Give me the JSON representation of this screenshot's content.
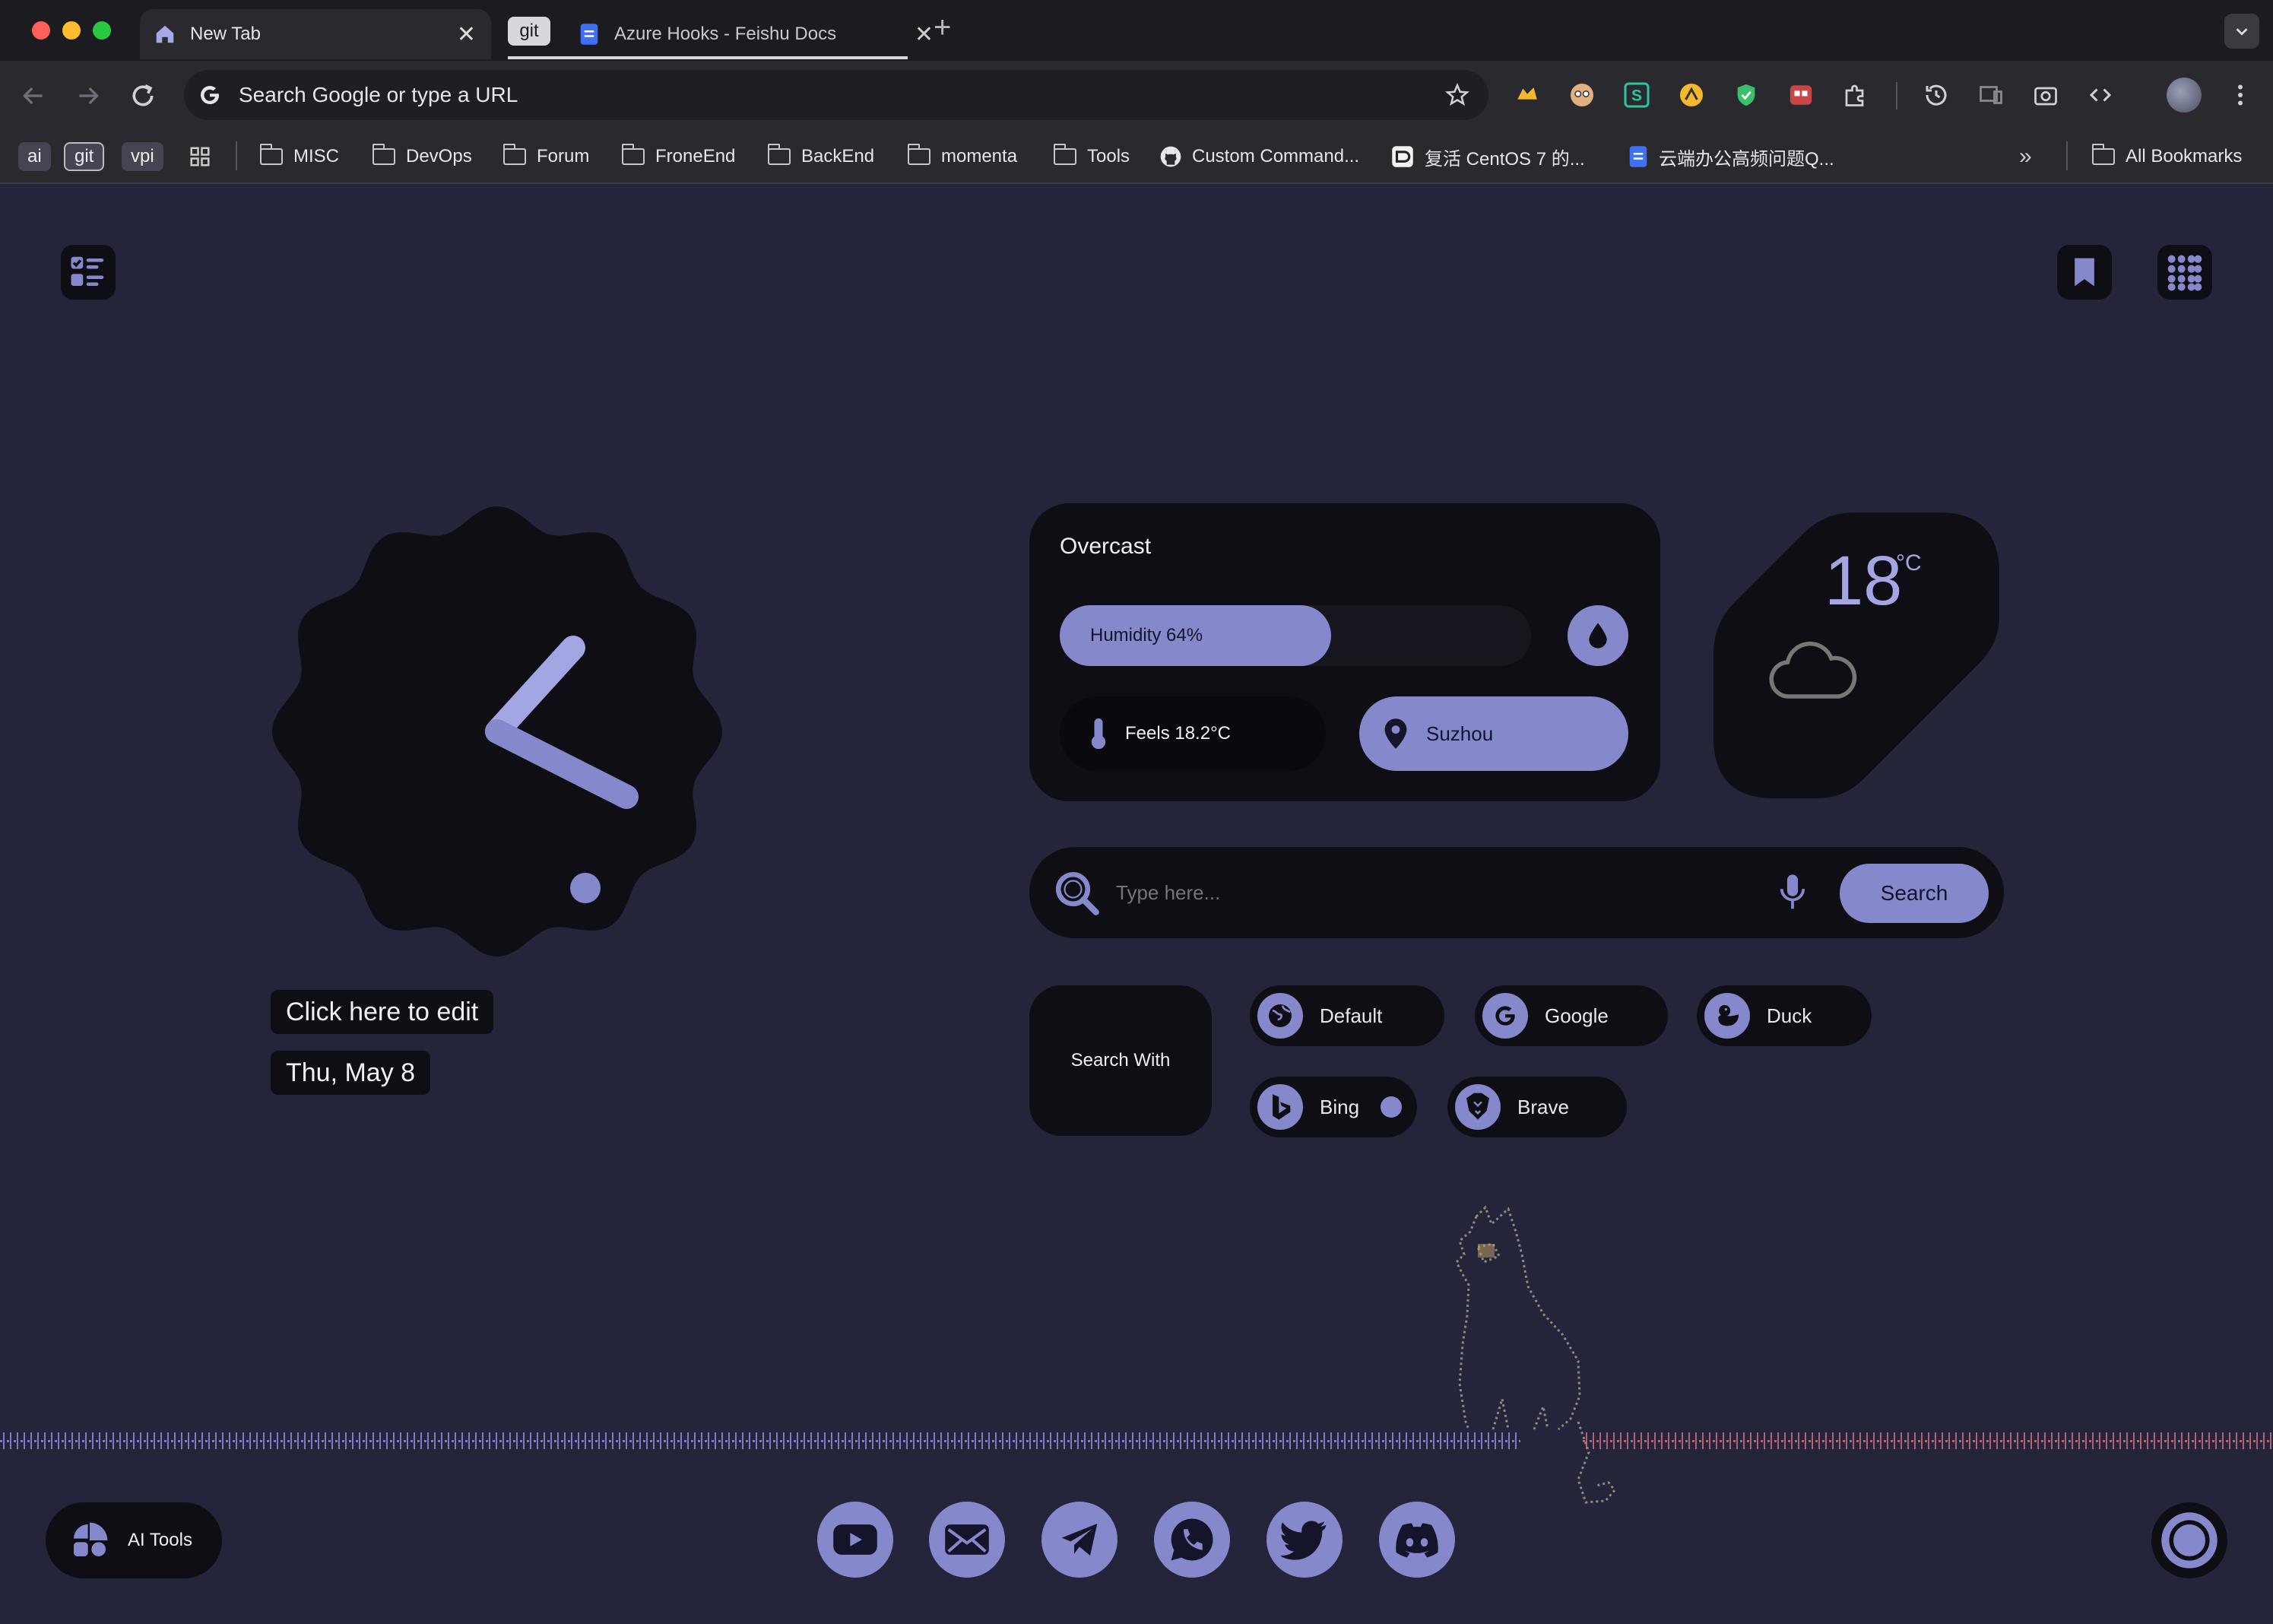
{
  "browser": {
    "tabs": [
      {
        "label": "New Tab",
        "active": true
      },
      {
        "label": "Azure Hooks - Feishu Docs",
        "group": "git",
        "active": false
      }
    ],
    "omnibox_placeholder": "Search Google or type a URL",
    "bookmark_chips": [
      "ai",
      "git",
      "vpi"
    ],
    "bookmarks": [
      "MISC",
      "DevOps",
      "Forum",
      "FroneEnd",
      "BackEnd",
      "momenta",
      "Tools",
      "Custom Command...",
      "复活 CentOS 7 的...",
      "云端办公高频问题Q..."
    ],
    "all_bookmarks": "All Bookmarks"
  },
  "clock": {
    "edit_label": "Click here to edit",
    "date": "Thu, May 8"
  },
  "weather": {
    "condition": "Overcast",
    "humidity": "Humidity 64%",
    "humidity_value": 64,
    "feels": "Feels 18.2°C",
    "location": "Suzhou",
    "temperature": "18",
    "unit": "°C"
  },
  "search": {
    "placeholder": "Type here...",
    "button": "Search",
    "search_with": "Search With",
    "engines": [
      {
        "label": "Default",
        "icon": "globe-icon"
      },
      {
        "label": "Google",
        "icon": "google-icon"
      },
      {
        "label": "Duck",
        "icon": "duck-icon"
      },
      {
        "label": "Bing",
        "icon": "bing-icon",
        "selected": true
      },
      {
        "label": "Brave",
        "icon": "brave-icon"
      }
    ]
  },
  "ai_tools_label": "AI Tools",
  "dock": [
    "youtube-icon",
    "mail-icon",
    "telegram-icon",
    "whatsapp-icon",
    "twitter-icon",
    "discord-icon"
  ],
  "colors": {
    "accent": "#8688cc",
    "card": "#0e0e14",
    "background": "#24243a"
  }
}
